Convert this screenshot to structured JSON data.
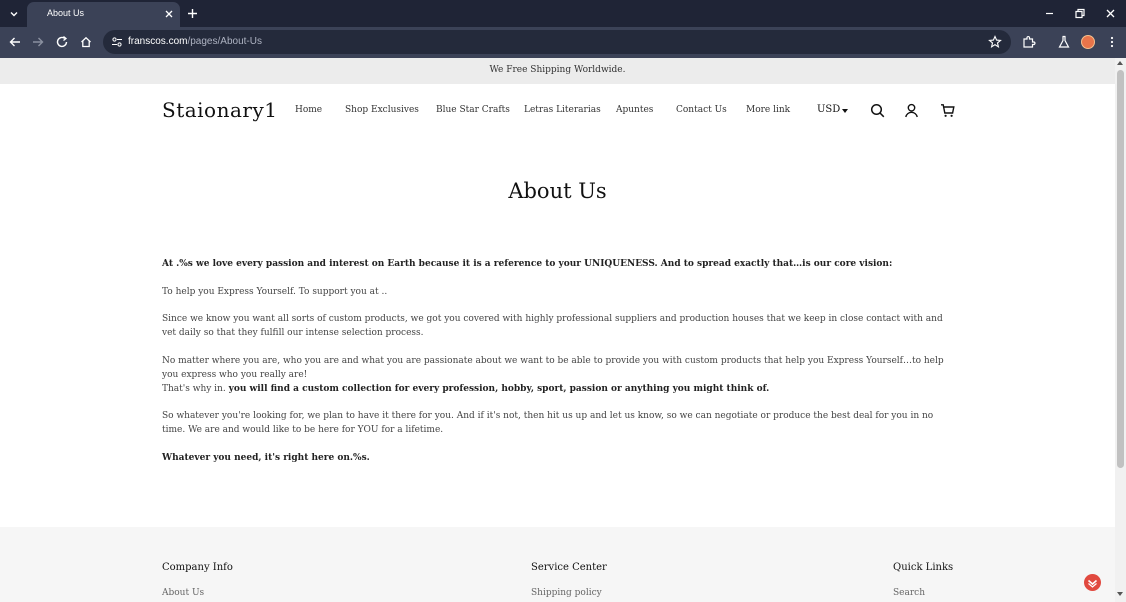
{
  "browser": {
    "tab_title": "About Us",
    "url_domain": "franscos.com",
    "url_path": "/pages/About-Us"
  },
  "announcement": "We Free Shipping Worldwide.",
  "header": {
    "logo": "Staionary1",
    "nav": [
      "Home",
      "Shop Exclusives",
      "Blue Star Crafts",
      "Letras Literarias",
      "Apuntes",
      "Contact Us",
      "More link"
    ],
    "currency": "USD"
  },
  "content": {
    "title": "About Us",
    "paragraphs": [
      "At .%s we love every passion and interest on Earth because it is a reference to your UNIQUENESS. And to spread exactly that…is our core vision:",
      "To help you Express Yourself. To support you at ..",
      "Since we know you want all sorts of custom products, we got you covered with highly professional suppliers and production houses that we keep in close contact with and vet daily so that they fulfill our intense selection process.",
      "No matter where you are, who you are and what you are passionate about we want to be able to provide you with custom products that help you Express Yourself…to help you express who you really are!",
      "That's why in.",
      "you will find a custom collection for every profession, hobby, sport, passion or anything you might think of.",
      "So whatever you're looking for, we plan to have it there for you. And if it's not, then hit us up and let us know, so we can negotiate or produce the best deal for you in no time. We are and would like to be here for YOU for a lifetime.",
      "Whatever you need, it's right here on.%s."
    ]
  },
  "footer": {
    "columns": [
      {
        "heading": "Company Info",
        "first_link": "About Us"
      },
      {
        "heading": "Service Center",
        "first_link": "Shipping policy"
      },
      {
        "heading": "Quick Links",
        "first_link": "Search"
      }
    ]
  },
  "colors": {
    "chrome_dark": "#1f2436",
    "chrome_toolbar": "#3b4257",
    "announcement_bg": "#ececec",
    "footer_bg": "#f6f6f6",
    "chat_accent": "#e1493f"
  },
  "icons": [
    "tab-search-icon",
    "close-icon",
    "plus-icon",
    "minimize-icon",
    "restore-icon",
    "back-icon",
    "forward-icon",
    "reload-icon",
    "home-icon",
    "site-info-icon",
    "star-icon",
    "extensions-icon",
    "labs-icon",
    "menu-icon",
    "search-icon",
    "account-icon",
    "cart-icon",
    "chat-icon"
  ]
}
